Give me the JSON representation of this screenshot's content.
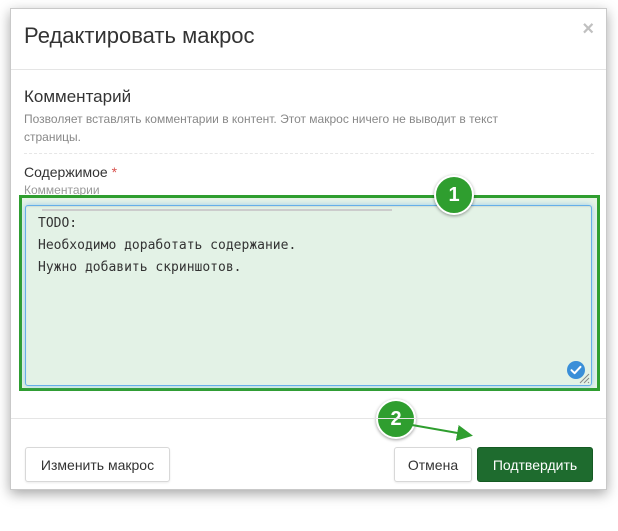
{
  "dialog": {
    "title": "Редактировать макрос",
    "close_label": "×"
  },
  "section": {
    "title": "Комментарий",
    "description": "Позволяет вставлять комментарии в контент. Этот макрос ничего не выводит в текст страницы."
  },
  "field": {
    "label": "Содержимое",
    "required_mark": "*",
    "hint": "Комментарии",
    "lines": [
      "TODO:",
      "Необходимо доработать содержание.",
      "Нужно добавить скриншотов."
    ]
  },
  "annotations": {
    "badge1": "1",
    "badge2": "2",
    "color": "#2f9e2f"
  },
  "footer": {
    "edit_label": "Изменить макрос",
    "cancel_label": "Отмена",
    "confirm_label": "Подтвердить"
  },
  "colors": {
    "primary": "#1e6b2e",
    "highlight": "#2f9e2f",
    "textarea_bg": "#e3f2e6",
    "focus_border": "#66afe9"
  }
}
